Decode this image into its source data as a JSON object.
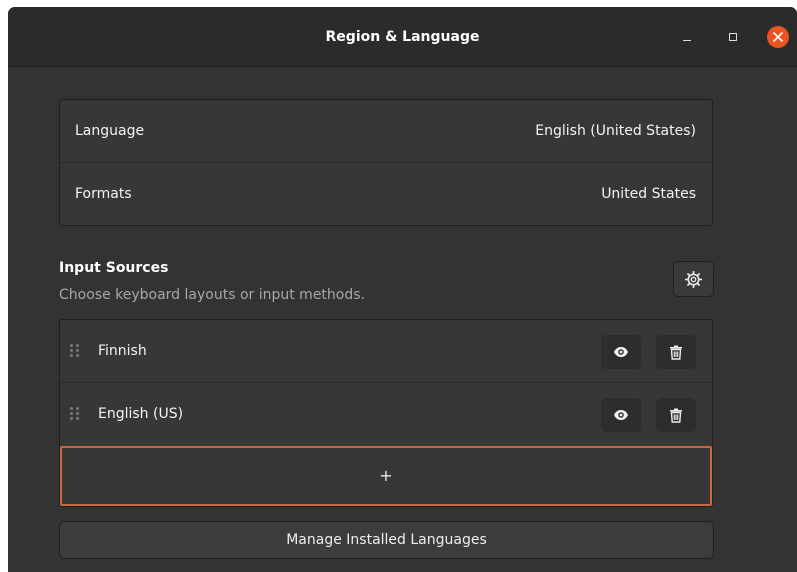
{
  "window": {
    "title": "Region & Language",
    "controls": {
      "minimize_icon": "minimize-icon",
      "maximize_icon": "maximize-icon",
      "close_icon": "close-icon",
      "close_color": "#e95420"
    }
  },
  "locale": {
    "rows": [
      {
        "label": "Language",
        "value": "English (United States)"
      },
      {
        "label": "Formats",
        "value": "United States"
      }
    ]
  },
  "input_sources": {
    "title": "Input Sources",
    "subtitle": "Choose keyboard layouts or input methods.",
    "options_icon": "gear-icon",
    "items": [
      {
        "label": "Finnish",
        "show_icon": "eye-icon",
        "remove_icon": "trash-icon"
      },
      {
        "label": "English (US)",
        "show_icon": "eye-icon",
        "remove_icon": "trash-icon"
      }
    ],
    "add_label": "+",
    "add_border_color": "#c86744"
  },
  "manage_button": "Manage Installed Languages"
}
